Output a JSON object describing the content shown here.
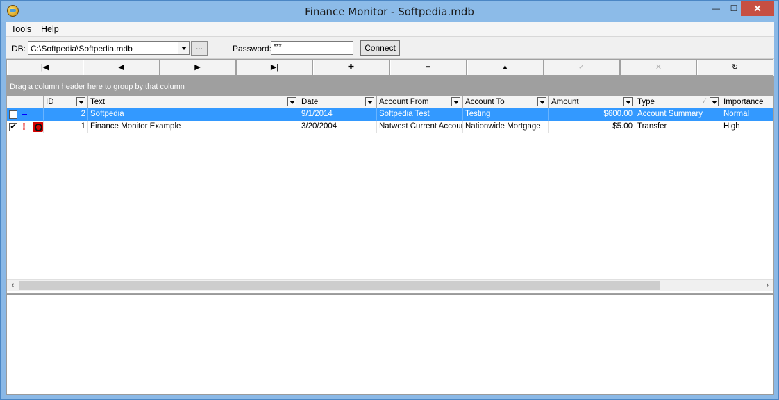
{
  "window": {
    "title": "Finance Monitor - Softpedia.mdb",
    "minimize_label": "—",
    "maximize_label": "☐",
    "close_label": "✕"
  },
  "menu": {
    "items": [
      {
        "label": "Tools"
      },
      {
        "label": "Help"
      }
    ]
  },
  "connection": {
    "db_label": "DB:",
    "db_path": "C:\\Softpedia\\Softpedia.mdb",
    "browse_label": "...",
    "password_label": "Password:",
    "password_value": "***",
    "connect_label": "Connect"
  },
  "navigator": {
    "buttons": [
      {
        "name": "nav-first-button",
        "icon": "first-record-icon",
        "glyph": "|◀",
        "enabled": true
      },
      {
        "name": "nav-prior-button",
        "icon": "prior-record-icon",
        "glyph": "◀",
        "enabled": true
      },
      {
        "name": "nav-next-button",
        "icon": "next-record-icon",
        "glyph": "▶",
        "enabled": true
      },
      {
        "name": "nav-last-button",
        "icon": "last-record-icon",
        "glyph": "▶|",
        "enabled": true
      },
      {
        "name": "nav-insert-button",
        "icon": "plus-icon",
        "glyph": "✚",
        "enabled": true
      },
      {
        "name": "nav-delete-button",
        "icon": "minus-icon",
        "glyph": "━",
        "enabled": true
      },
      {
        "name": "nav-edit-button",
        "icon": "up-triangle-icon",
        "glyph": "▲",
        "enabled": true
      },
      {
        "name": "nav-post-button",
        "icon": "check-icon",
        "glyph": "✓",
        "enabled": false
      },
      {
        "name": "nav-cancel-button",
        "icon": "x-icon",
        "glyph": "✕",
        "enabled": false
      },
      {
        "name": "nav-refresh-button",
        "icon": "refresh-icon",
        "glyph": "↻",
        "enabled": true
      }
    ]
  },
  "grid": {
    "group_hint": "Drag a column header here to group by that column",
    "columns": [
      {
        "label": "ID"
      },
      {
        "label": "Text"
      },
      {
        "label": "Date"
      },
      {
        "label": "Account From"
      },
      {
        "label": "Account To"
      },
      {
        "label": "Amount"
      },
      {
        "label": "Type"
      },
      {
        "label": "Importance"
      }
    ],
    "rows": [
      {
        "checked": false,
        "priority": "normal",
        "id": "2",
        "text": "Softpedia",
        "date": "9/1/2014",
        "account_from": "Softpedia Test",
        "account_to": "Testing",
        "amount": "$600.00",
        "type": "Account Summary",
        "importance": "Normal",
        "selected": true
      },
      {
        "checked": true,
        "priority": "high",
        "id": "1",
        "text": "Finance Monitor Example",
        "date": "3/20/2004",
        "account_from": "Natwest Current Account",
        "account_to": "Nationwide Mortgage",
        "amount": "$5.00",
        "type": "Transfer",
        "importance": "High",
        "selected": false
      }
    ]
  },
  "colors": {
    "selection": "#3399ff",
    "group_panel": "#9f9f9f",
    "titlebar": "#8cbbe8",
    "close_button": "#c74f42"
  }
}
